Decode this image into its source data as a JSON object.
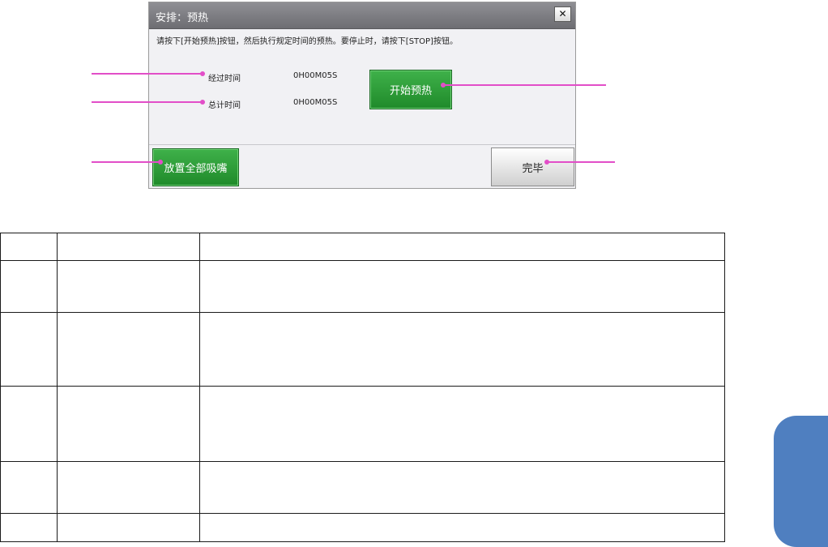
{
  "dialog": {
    "title": "安排：预热",
    "close_label": "✕",
    "instruction": "请按下[开始预热]按钮，然后执行规定时间的预热。要停止时，请按下[STOP]按钮。",
    "elapsed_label": "经过时间",
    "elapsed_value": "0H00M05S",
    "total_label": "总计时间",
    "total_value": "0H00M05S",
    "start_button": "开始预热",
    "place_all_button": "放置全部吸嘴",
    "done_button": "完毕"
  },
  "colors": {
    "callout": "#e24ec8",
    "accent_green": "#2a9a34",
    "side_tab": "#4f7fc0"
  },
  "table": {
    "rows": 6,
    "columns": 3
  }
}
